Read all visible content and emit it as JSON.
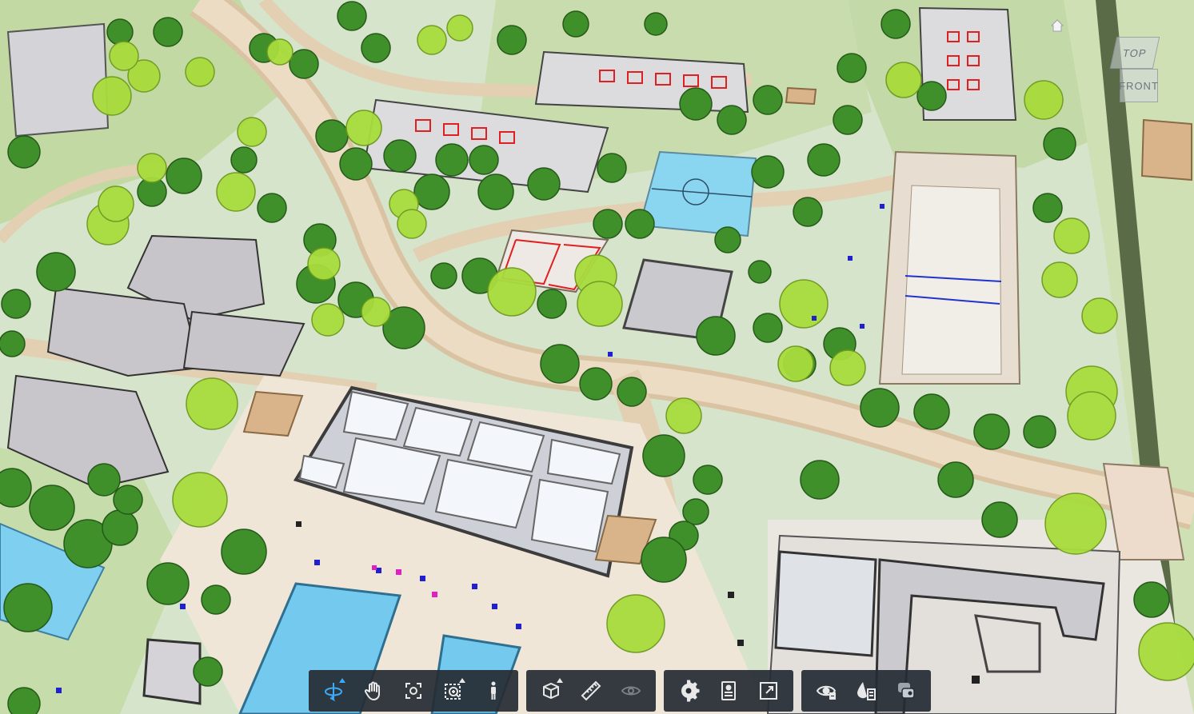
{
  "viewer": {
    "colors": {
      "grass": "#c9dcb0",
      "pavement": "#efe9df",
      "path": "#e7d6bd",
      "pool": "#79d0f0",
      "roof": "#cfcfd4",
      "tree_dark": "#3d8c2a",
      "tree_light": "#a7dc3a",
      "toolbar_bg": "#262c34",
      "active_accent": "#3fa9f5"
    }
  },
  "viewcube": {
    "top_label": "TOP",
    "front_label": "FRONT"
  },
  "toolbar": {
    "groups": [
      {
        "tools": [
          {
            "icon": "orbit-icon",
            "active": true,
            "has_flyout": true
          },
          {
            "icon": "pan-icon"
          },
          {
            "icon": "fit-to-view-icon"
          },
          {
            "icon": "zoom-window-icon",
            "has_flyout": true
          },
          {
            "icon": "first-person-icon"
          }
        ]
      },
      {
        "tools": [
          {
            "icon": "section-box-icon",
            "has_flyout": true
          },
          {
            "icon": "measure-icon"
          },
          {
            "icon": "explode-icon",
            "disabled": true
          }
        ]
      },
      {
        "tools": [
          {
            "icon": "settings-icon"
          },
          {
            "icon": "properties-icon"
          },
          {
            "icon": "fullscreen-icon"
          }
        ]
      },
      {
        "tools": [
          {
            "icon": "visibility-icon"
          },
          {
            "icon": "filter-icon"
          },
          {
            "icon": "layers-icon"
          }
        ]
      }
    ]
  }
}
